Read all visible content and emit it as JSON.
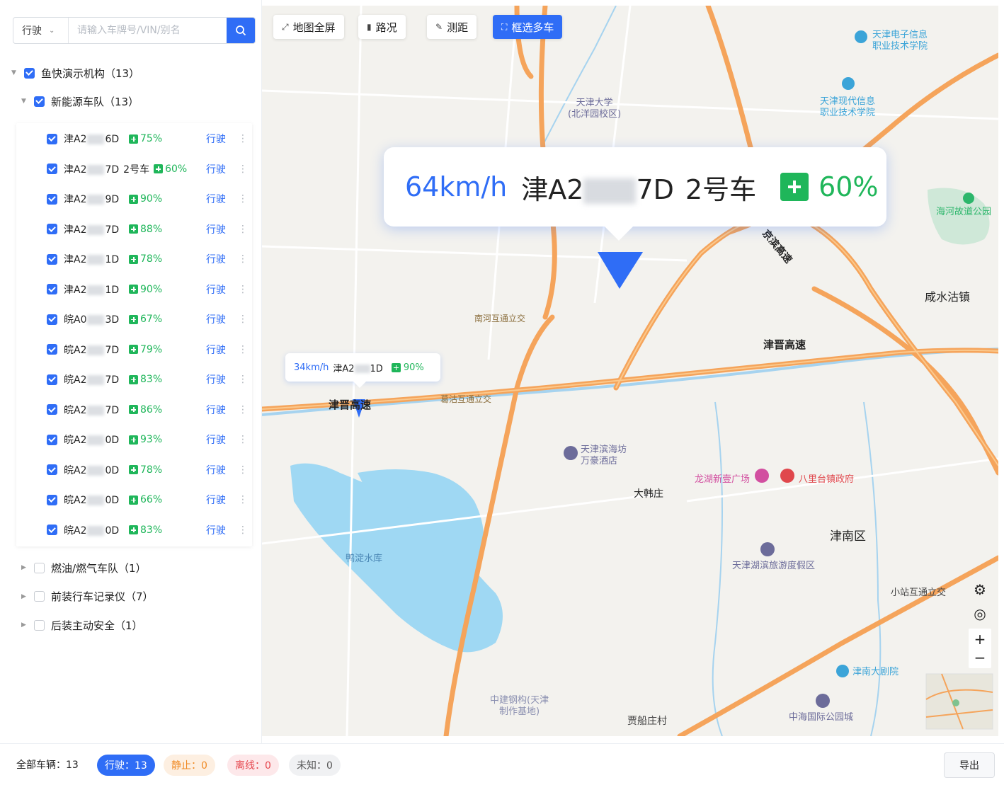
{
  "search": {
    "mode": "行驶",
    "placeholder": "请输入车牌号/VIN/别名"
  },
  "tree": {
    "org": {
      "label": "鱼快演示机构（13）",
      "checked": true
    },
    "fleet": {
      "label": "新能源车队（13）",
      "checked": true
    },
    "vehicles": [
      {
        "prefix": "津A2",
        "suffix": "6D",
        "name": "",
        "battery": "75%",
        "status": "行驶"
      },
      {
        "prefix": "津A2",
        "suffix": "7D",
        "name": "2号车",
        "battery": "60%",
        "status": "行驶"
      },
      {
        "prefix": "津A2",
        "suffix": "9D",
        "name": "",
        "battery": "90%",
        "status": "行驶"
      },
      {
        "prefix": "津A2",
        "suffix": "7D",
        "name": "",
        "battery": "88%",
        "status": "行驶"
      },
      {
        "prefix": "津A2",
        "suffix": "1D",
        "name": "",
        "battery": "78%",
        "status": "行驶"
      },
      {
        "prefix": "津A2",
        "suffix": "1D",
        "name": "",
        "battery": "90%",
        "status": "行驶"
      },
      {
        "prefix": "皖A0",
        "suffix": "3D",
        "name": "",
        "battery": "67%",
        "status": "行驶"
      },
      {
        "prefix": "皖A2",
        "suffix": "7D",
        "name": "",
        "battery": "79%",
        "status": "行驶"
      },
      {
        "prefix": "皖A2",
        "suffix": "7D",
        "name": "",
        "battery": "83%",
        "status": "行驶"
      },
      {
        "prefix": "皖A2",
        "suffix": "7D",
        "name": "",
        "battery": "86%",
        "status": "行驶"
      },
      {
        "prefix": "皖A2",
        "suffix": "0D",
        "name": "",
        "battery": "93%",
        "status": "行驶"
      },
      {
        "prefix": "皖A2",
        "suffix": "0D",
        "name": "",
        "battery": "78%",
        "status": "行驶"
      },
      {
        "prefix": "皖A2",
        "suffix": "0D",
        "name": "",
        "battery": "66%",
        "status": "行驶"
      },
      {
        "prefix": "皖A2",
        "suffix": "0D",
        "name": "",
        "battery": "83%",
        "status": "行驶"
      }
    ],
    "other_groups": [
      {
        "label": "燃油/燃气车队（1）"
      },
      {
        "label": "前装行车记录仪（7）"
      },
      {
        "label": "后装主动安全（1）"
      }
    ]
  },
  "toolbar": {
    "fullscreen": "地图全屏",
    "traffic": "路况",
    "measure": "测距",
    "select_multi": "框选多车"
  },
  "popup_main": {
    "speed": "64km/h",
    "plate_prefix": "津A2",
    "plate_suffix": "7D",
    "name": "2号车",
    "battery": "60%"
  },
  "popup_small": {
    "speed": "34km/h",
    "plate_prefix": "津A2",
    "plate_suffix": "1D",
    "battery": "90%"
  },
  "map_labels": {
    "tju": "天津大学\n(北洋园校区)",
    "tj_electronic": "天津电子信息\n职业技术学院",
    "tj_modern": "天津现代信息\n职业技术学院",
    "jingbin": "京滨高速",
    "jinjin": "津晋高速",
    "jinjin_left": "津晋高速",
    "xianshuigu": "咸水沽镇",
    "dahanzhuang": "大韩庄",
    "jinnan": "津南区",
    "yayuan": "鸭淀水库",
    "baliitai": "八里台镇政府",
    "longhu": "龙湖新壹广场",
    "hotel": "天津滨海坊\n万豪酒店",
    "park_area": "天津湖滨旅游度假区",
    "xiaozhan": "小站互通立交",
    "jinnan_theatre": "津南大剧院",
    "zhonghai": "中海国际公园城",
    "zhongjian": "中建钢构(天津\n制作基地)",
    "jiachangzhuang": "贾船庄村",
    "lidao": "海河故道公园",
    "interchange1": "南河互通立交",
    "interchange2": "葛沽互通立交"
  },
  "footer": {
    "total": "全部车辆：13",
    "running": "行驶：13",
    "stopped": "静止：0",
    "offline": "离线：0",
    "unknown": "未知：0",
    "export": "导出"
  },
  "colors": {
    "accent": "#2f6df6",
    "battery": "#1fb65a",
    "road": "#f5a45b"
  }
}
